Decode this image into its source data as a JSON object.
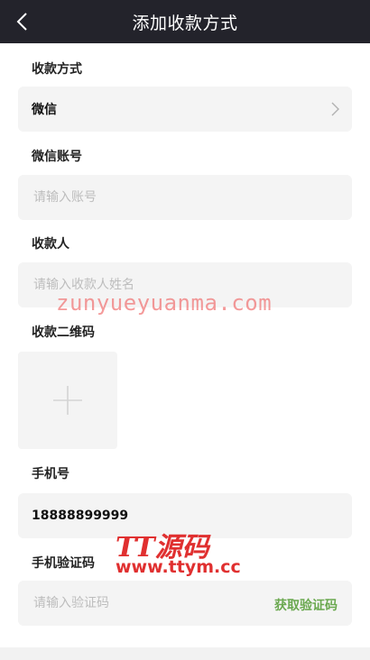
{
  "header": {
    "title": "添加收款方式"
  },
  "form": {
    "method": {
      "label": "收款方式",
      "value": "微信"
    },
    "account": {
      "label": "微信账号",
      "placeholder": "请输入账号",
      "value": ""
    },
    "payee": {
      "label": "收款人",
      "placeholder": "请输入收款人姓名",
      "value": ""
    },
    "qrcode": {
      "label": "收款二维码"
    },
    "phone": {
      "label": "手机号",
      "value": "18888899999"
    },
    "verify": {
      "label": "手机验证码",
      "placeholder": "请输入验证码",
      "value": "",
      "get_code_label": "获取验证码"
    }
  },
  "watermarks": {
    "url": "zunyueyuanma.com",
    "logo_big": "TT源码",
    "logo_small": "www.ttym.cc"
  },
  "colors": {
    "header_bg": "#23232b",
    "field_bg": "#f4f4f4",
    "accent_green": "#6aa84f",
    "watermark_red": "#e03030"
  }
}
